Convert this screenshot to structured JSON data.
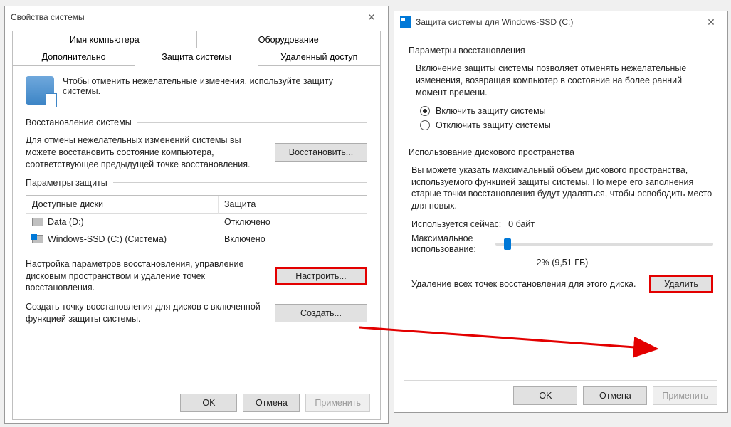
{
  "win1": {
    "title": "Свойства системы",
    "tabs_row1": [
      "Имя компьютера",
      "Оборудование"
    ],
    "tabs_row2": [
      "Дополнительно",
      "Защита системы",
      "Удаленный доступ"
    ],
    "active_tab": "Защита системы",
    "intro": "Чтобы отменить нежелательные изменения, используйте защиту системы.",
    "restore_group": "Восстановление системы",
    "restore_text": "Для отмены нежелательных изменений системы вы можете восстановить состояние компьютера, соответствующее предыдущей точке восстановления.",
    "restore_btn": "Восстановить...",
    "params_group": "Параметры защиты",
    "col_disks": "Доступные диски",
    "col_protection": "Защита",
    "disks": [
      {
        "name": "Data (D:)",
        "protection": "Отключено",
        "system": false
      },
      {
        "name": "Windows-SSD (C:) (Система)",
        "protection": "Включено",
        "system": true
      }
    ],
    "configure_text": "Настройка параметров восстановления, управление дисковым пространством и удаление точек восстановления.",
    "configure_btn": "Настроить...",
    "create_text": "Создать точку восстановления для дисков с включенной функцией защиты системы.",
    "create_btn": "Создать...",
    "ok": "OK",
    "cancel": "Отмена",
    "apply": "Применить"
  },
  "win2": {
    "title": "Защита системы для Windows-SSD (C:)",
    "restore_params": "Параметры восстановления",
    "restore_desc": "Включение защиты системы позволяет отменять нежелательные изменения, возвращая компьютер в состояние на более ранний момент времени.",
    "radio_on": "Включить защиту системы",
    "radio_off": "Отключить защиту системы",
    "disk_usage": "Использование дискового пространства",
    "disk_desc": "Вы можете указать максимальный объем дискового пространства, используемого функцией защиты системы. По мере его заполнения старые точки восстановления будут удаляться, чтобы освободить место для новых.",
    "used_label": "Используется сейчас:",
    "used_value": "0 байт",
    "max_label": "Максимальное использование:",
    "slider_value": "2% (9,51 ГБ)",
    "delete_text": "Удаление всех точек восстановления для этого диска.",
    "delete_btn": "Удалить",
    "ok": "OK",
    "cancel": "Отмена",
    "apply": "Применить"
  }
}
